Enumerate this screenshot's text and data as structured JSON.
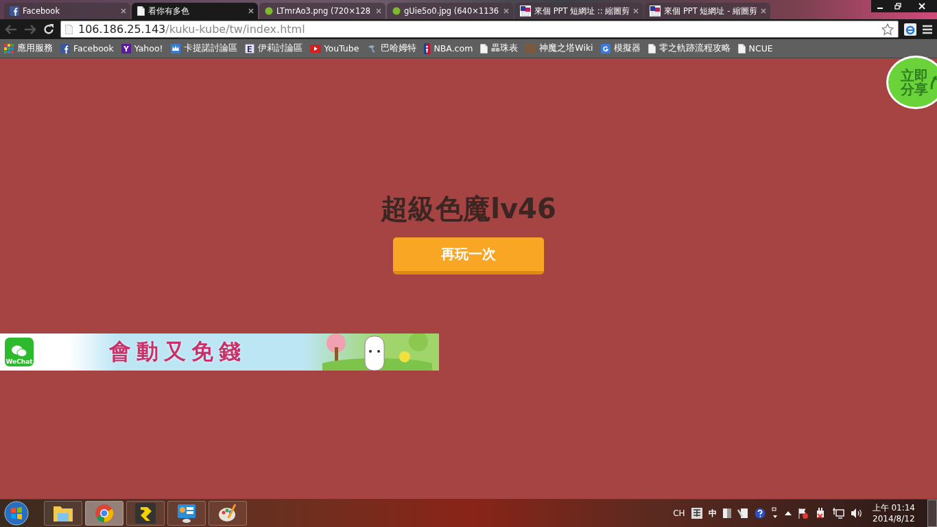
{
  "tabs": [
    {
      "title": "Facebook",
      "kind": "facebook",
      "selected": false
    },
    {
      "title": "看你有多色",
      "kind": "page",
      "selected": true
    },
    {
      "title": "LTmrAo3.png (720×128",
      "kind": "image",
      "selected": false
    },
    {
      "title": "gUie5o0.jpg (640×1136",
      "kind": "image",
      "selected": false
    },
    {
      "title": "來個 PPT 短網址 :: 縮圖剪",
      "kind": "ppt",
      "selected": false
    },
    {
      "title": "來個 PPT 短網址 - 縮圖剪",
      "kind": "ppt",
      "selected": false
    }
  ],
  "address": {
    "host": "106.186.25.143",
    "path": "/kuku-kube/tw/index.html"
  },
  "bookmarks": [
    {
      "label": "應用服務",
      "kind": "apps"
    },
    {
      "label": "Facebook",
      "kind": "facebook"
    },
    {
      "label": "Yahoo!",
      "kind": "yahoo"
    },
    {
      "label": "卡提諾討論區",
      "kind": "crown"
    },
    {
      "label": "伊莉討論區",
      "kind": "letter"
    },
    {
      "label": "YouTube",
      "kind": "youtube"
    },
    {
      "label": "巴哈姆特",
      "kind": "dragon"
    },
    {
      "label": "NBA.com",
      "kind": "nba"
    },
    {
      "label": "畾珠表",
      "kind": "page"
    },
    {
      "label": "神魔之塔Wiki",
      "kind": "photo"
    },
    {
      "label": "模擬器",
      "kind": "google"
    },
    {
      "label": "零之軌跡流程攻略",
      "kind": "page"
    },
    {
      "label": "NCUE",
      "kind": "page"
    }
  ],
  "share_badge": {
    "label": "立即分享"
  },
  "result": {
    "title": "超級色魔lv46",
    "button": "再玩一次"
  },
  "banner": {
    "app_label": "WeChat",
    "slogan": "會動又免錢"
  },
  "taskbar": {
    "apps": [
      {
        "kind": "folder",
        "active": false
      },
      {
        "kind": "browser",
        "active": true
      },
      {
        "kind": "launcher",
        "active": false
      },
      {
        "kind": "monitor",
        "active": false
      },
      {
        "kind": "paint",
        "active": false
      }
    ],
    "language": "CH",
    "ime": "中",
    "time": "上午 01:14",
    "date": "2014/8/12"
  }
}
